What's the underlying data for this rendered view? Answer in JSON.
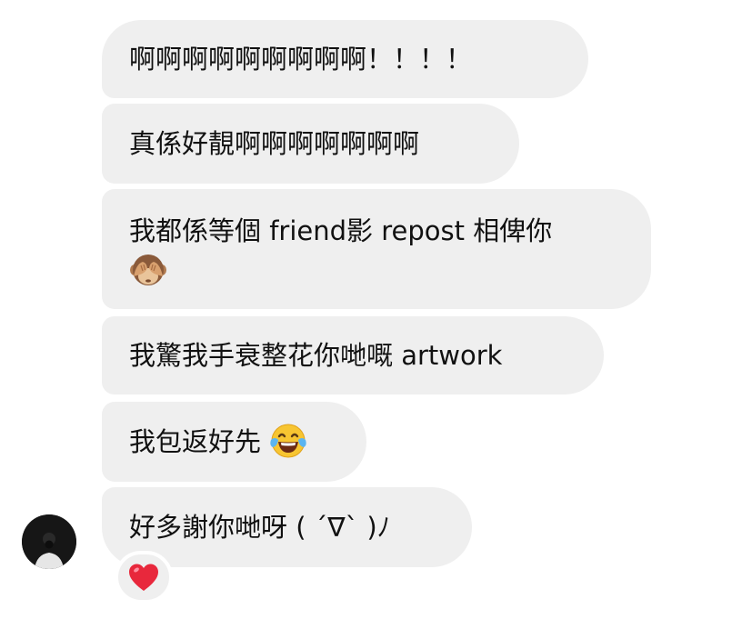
{
  "messages": [
    {
      "text": "啊啊啊啊啊啊啊啊啊！！！！"
    },
    {
      "text": "真係好靚啊啊啊啊啊啊啊"
    },
    {
      "text_line1": "我都係等個 friend影 repost 相俾你",
      "emoji": "see-no-evil-monkey"
    },
    {
      "text": "我驚我手衰整花你哋嘅 artwork"
    },
    {
      "text": "我包返好先",
      "emoji": "face-with-tears-of-joy"
    },
    {
      "text": "好多謝你哋呀 ( ´∇` )ﾉ"
    }
  ],
  "reaction": {
    "emoji": "red-heart",
    "color": "#e8283c"
  },
  "colors": {
    "bubble_bg": "#efefef",
    "text": "#111111",
    "background": "#ffffff"
  }
}
